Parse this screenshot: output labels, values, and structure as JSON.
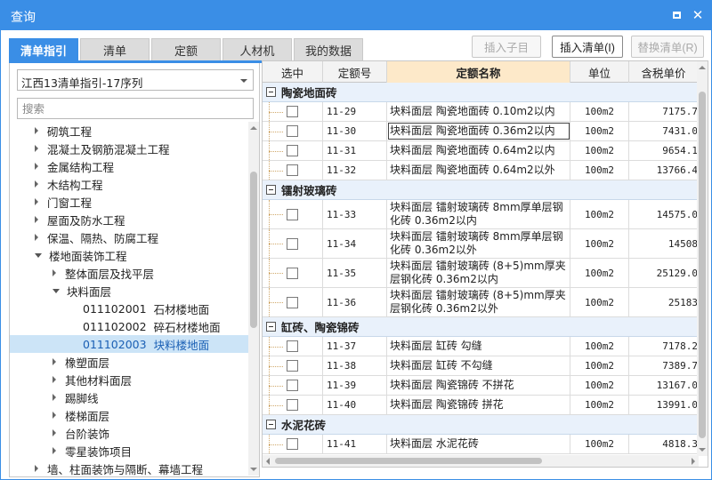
{
  "window": {
    "title": "查询"
  },
  "tabs": [
    {
      "label": "清单指引",
      "active": true
    },
    {
      "label": "清单",
      "active": false
    },
    {
      "label": "定额",
      "active": false
    },
    {
      "label": "人材机",
      "active": false
    },
    {
      "label": "我的数据",
      "active": false
    }
  ],
  "buttons": {
    "insert_child": "插入子目",
    "insert_list": "插入清单(I)",
    "replace_list": "替换清单(R)"
  },
  "left": {
    "combo_value": "江西13清单指引-17序列",
    "search_placeholder": "搜索",
    "tree": [
      {
        "label": "砌筑工程",
        "level": 0,
        "state": "collapsed"
      },
      {
        "label": "混凝土及钢筋混凝土工程",
        "level": 0,
        "state": "collapsed"
      },
      {
        "label": "金属结构工程",
        "level": 0,
        "state": "collapsed"
      },
      {
        "label": "木结构工程",
        "level": 0,
        "state": "collapsed"
      },
      {
        "label": "门窗工程",
        "level": 0,
        "state": "collapsed"
      },
      {
        "label": "屋面及防水工程",
        "level": 0,
        "state": "collapsed"
      },
      {
        "label": "保温、隔热、防腐工程",
        "level": 0,
        "state": "collapsed"
      },
      {
        "label": "楼地面装饰工程",
        "level": 0,
        "state": "expanded"
      },
      {
        "label": "整体面层及找平层",
        "level": 1,
        "state": "collapsed"
      },
      {
        "label": "块料面层",
        "level": 1,
        "state": "expanded"
      },
      {
        "code": "011102001",
        "label": "石材楼地面",
        "level": 2,
        "state": "leaf"
      },
      {
        "code": "011102002",
        "label": "碎石材楼地面",
        "level": 2,
        "state": "leaf"
      },
      {
        "code": "011102003",
        "label": "块料楼地面",
        "level": 2,
        "state": "leaf",
        "selected": true
      },
      {
        "label": "橡塑面层",
        "level": 1,
        "state": "collapsed"
      },
      {
        "label": "其他材料面层",
        "level": 1,
        "state": "collapsed"
      },
      {
        "label": "踢脚线",
        "level": 1,
        "state": "collapsed"
      },
      {
        "label": "楼梯面层",
        "level": 1,
        "state": "collapsed"
      },
      {
        "label": "台阶装饰",
        "level": 1,
        "state": "collapsed"
      },
      {
        "label": "零星装饰项目",
        "level": 1,
        "state": "collapsed"
      },
      {
        "label": "墙、柱面装饰与隔断、幕墙工程",
        "level": 0,
        "state": "collapsed"
      }
    ]
  },
  "grid": {
    "headers": [
      "选中",
      "定额号",
      "定额名称",
      "单位",
      "含税单价"
    ],
    "groups": [
      {
        "name": "陶瓷地面砖",
        "rows": [
          {
            "code": "11-29",
            "name": "块料面层 陶瓷地面砖 0.10m2以内",
            "unit": "100m2",
            "price": "7175.7"
          },
          {
            "code": "11-30",
            "name": "块料面层 陶瓷地面砖 0.36m2以内",
            "unit": "100m2",
            "price": "7431.0",
            "focused": true
          },
          {
            "code": "11-31",
            "name": "块料面层 陶瓷地面砖 0.64m2以内",
            "unit": "100m2",
            "price": "9654.1"
          },
          {
            "code": "11-32",
            "name": "块料面层 陶瓷地面砖 0.64m2以外",
            "unit": "100m2",
            "price": "13766.4"
          }
        ]
      },
      {
        "name": "镭射玻璃砖",
        "rows": [
          {
            "code": "11-33",
            "name": "块料面层 镭射玻璃砖 8mm厚单层钢化砖 0.36m2以内",
            "unit": "100m2",
            "price": "14575.0"
          },
          {
            "code": "11-34",
            "name": "块料面层 镭射玻璃砖 8mm厚单层钢化砖 0.36m2以外",
            "unit": "100m2",
            "price": "14508"
          },
          {
            "code": "11-35",
            "name": "块料面层 镭射玻璃砖 (8+5)mm厚夹层钢化砖 0.36m2以内",
            "unit": "100m2",
            "price": "25129.0"
          },
          {
            "code": "11-36",
            "name": "块料面层 镭射玻璃砖 (8+5)mm厚夹层钢化砖 0.36m2以外",
            "unit": "100m2",
            "price": "25183"
          }
        ]
      },
      {
        "name": "缸砖、陶瓷锦砖",
        "rows": [
          {
            "code": "11-37",
            "name": "块料面层 缸砖 勾缝",
            "unit": "100m2",
            "price": "7178.2"
          },
          {
            "code": "11-38",
            "name": "块料面层 缸砖 不勾缝",
            "unit": "100m2",
            "price": "7389.7"
          },
          {
            "code": "11-39",
            "name": "块料面层 陶瓷锦砖 不拼花",
            "unit": "100m2",
            "price": "13167.0"
          },
          {
            "code": "11-40",
            "name": "块料面层 陶瓷锦砖 拼花",
            "unit": "100m2",
            "price": "13991.0"
          }
        ]
      },
      {
        "name": "水泥花砖",
        "rows": [
          {
            "code": "11-41",
            "name": "块料面层 水泥花砖",
            "unit": "100m2",
            "price": "4818.3"
          }
        ]
      }
    ]
  }
}
